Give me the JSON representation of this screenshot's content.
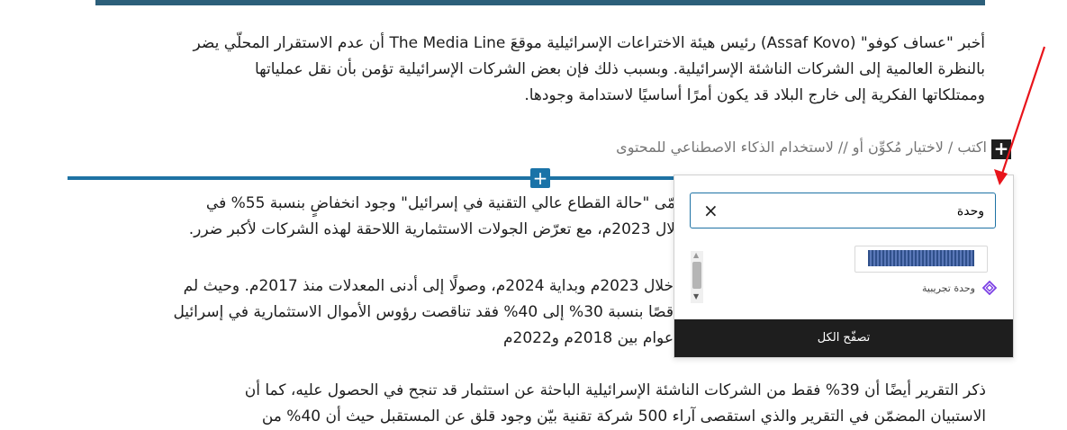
{
  "editor": {
    "paragraph1": {
      "line1": "أخبر \"عساف كوفو\" (Assaf Kovo) رئيس هيئة الاختراعات الإسرائيلية موقعَ The Media Line أن عدم الاستقرار المحلّي يضر",
      "line2": "بالنظرة العالمية إلى الشركات الناشئة الإسرائيلية. وبسبب ذلك فإن بعض الشركات الإسرائيلية تؤمن بأن نقل عملياتها",
      "line3": "وممتلكاتها الفكرية إلى خارج البلاد قد يكون أمرًا أساسيًا لاستدامة وجودها."
    },
    "block_placeholder": "اكتب / لاختيار مُكوِّن أو // لاستخدام الذكاء الاصطناعي للمحتوى",
    "add_block_icon": "plus-icon",
    "inserter_icon": "plus-icon",
    "paragraph2": {
      "line1": "مّى \"حالة القطاع عالي التقنية في إسرائيل\" وجود انخفاضٍ بنسبة 55% في",
      "line2": "لال 2023م، مع تعرّض الجولات الاستثمارية اللاحقة لهذه الشركات لأكبر ضرر."
    },
    "paragraph3": {
      "line1": "خلال 2023م وبداية 2024م، وصولًا إلى أدنى المعدلات منذ 2017م. وحيث لم",
      "line2": "قصًا بنسبة 30% إلى 40% فقد تناقصت رؤوس الأموال الاستثمارية في إسرائيل",
      "line3": "عوام بين 2018م و2022م"
    },
    "paragraph4": {
      "line1": "ذكر التقرير أيضًا أن 39% فقط من الشركات الناشئة الإسرائيلية الباحثة عن استثمار قد تنجح في الحصول عليه، كما أن",
      "line2": "الاستبيان المضمّن في التقرير والذي استقصى آراء 500 شركة تقنية بيّن وجود قلق عن المستقبل حيث أن 40% من"
    }
  },
  "inserter": {
    "search_value": "وحدة",
    "clear_icon": "close-icon",
    "result_label": "وحدة تجريبية",
    "result_icon": "diamond-icon",
    "browse_all_label": "تصفّح الكل"
  },
  "colors": {
    "accent": "#1e72a4",
    "annotation": "#e8141b",
    "dark": "#1e1e1e"
  }
}
